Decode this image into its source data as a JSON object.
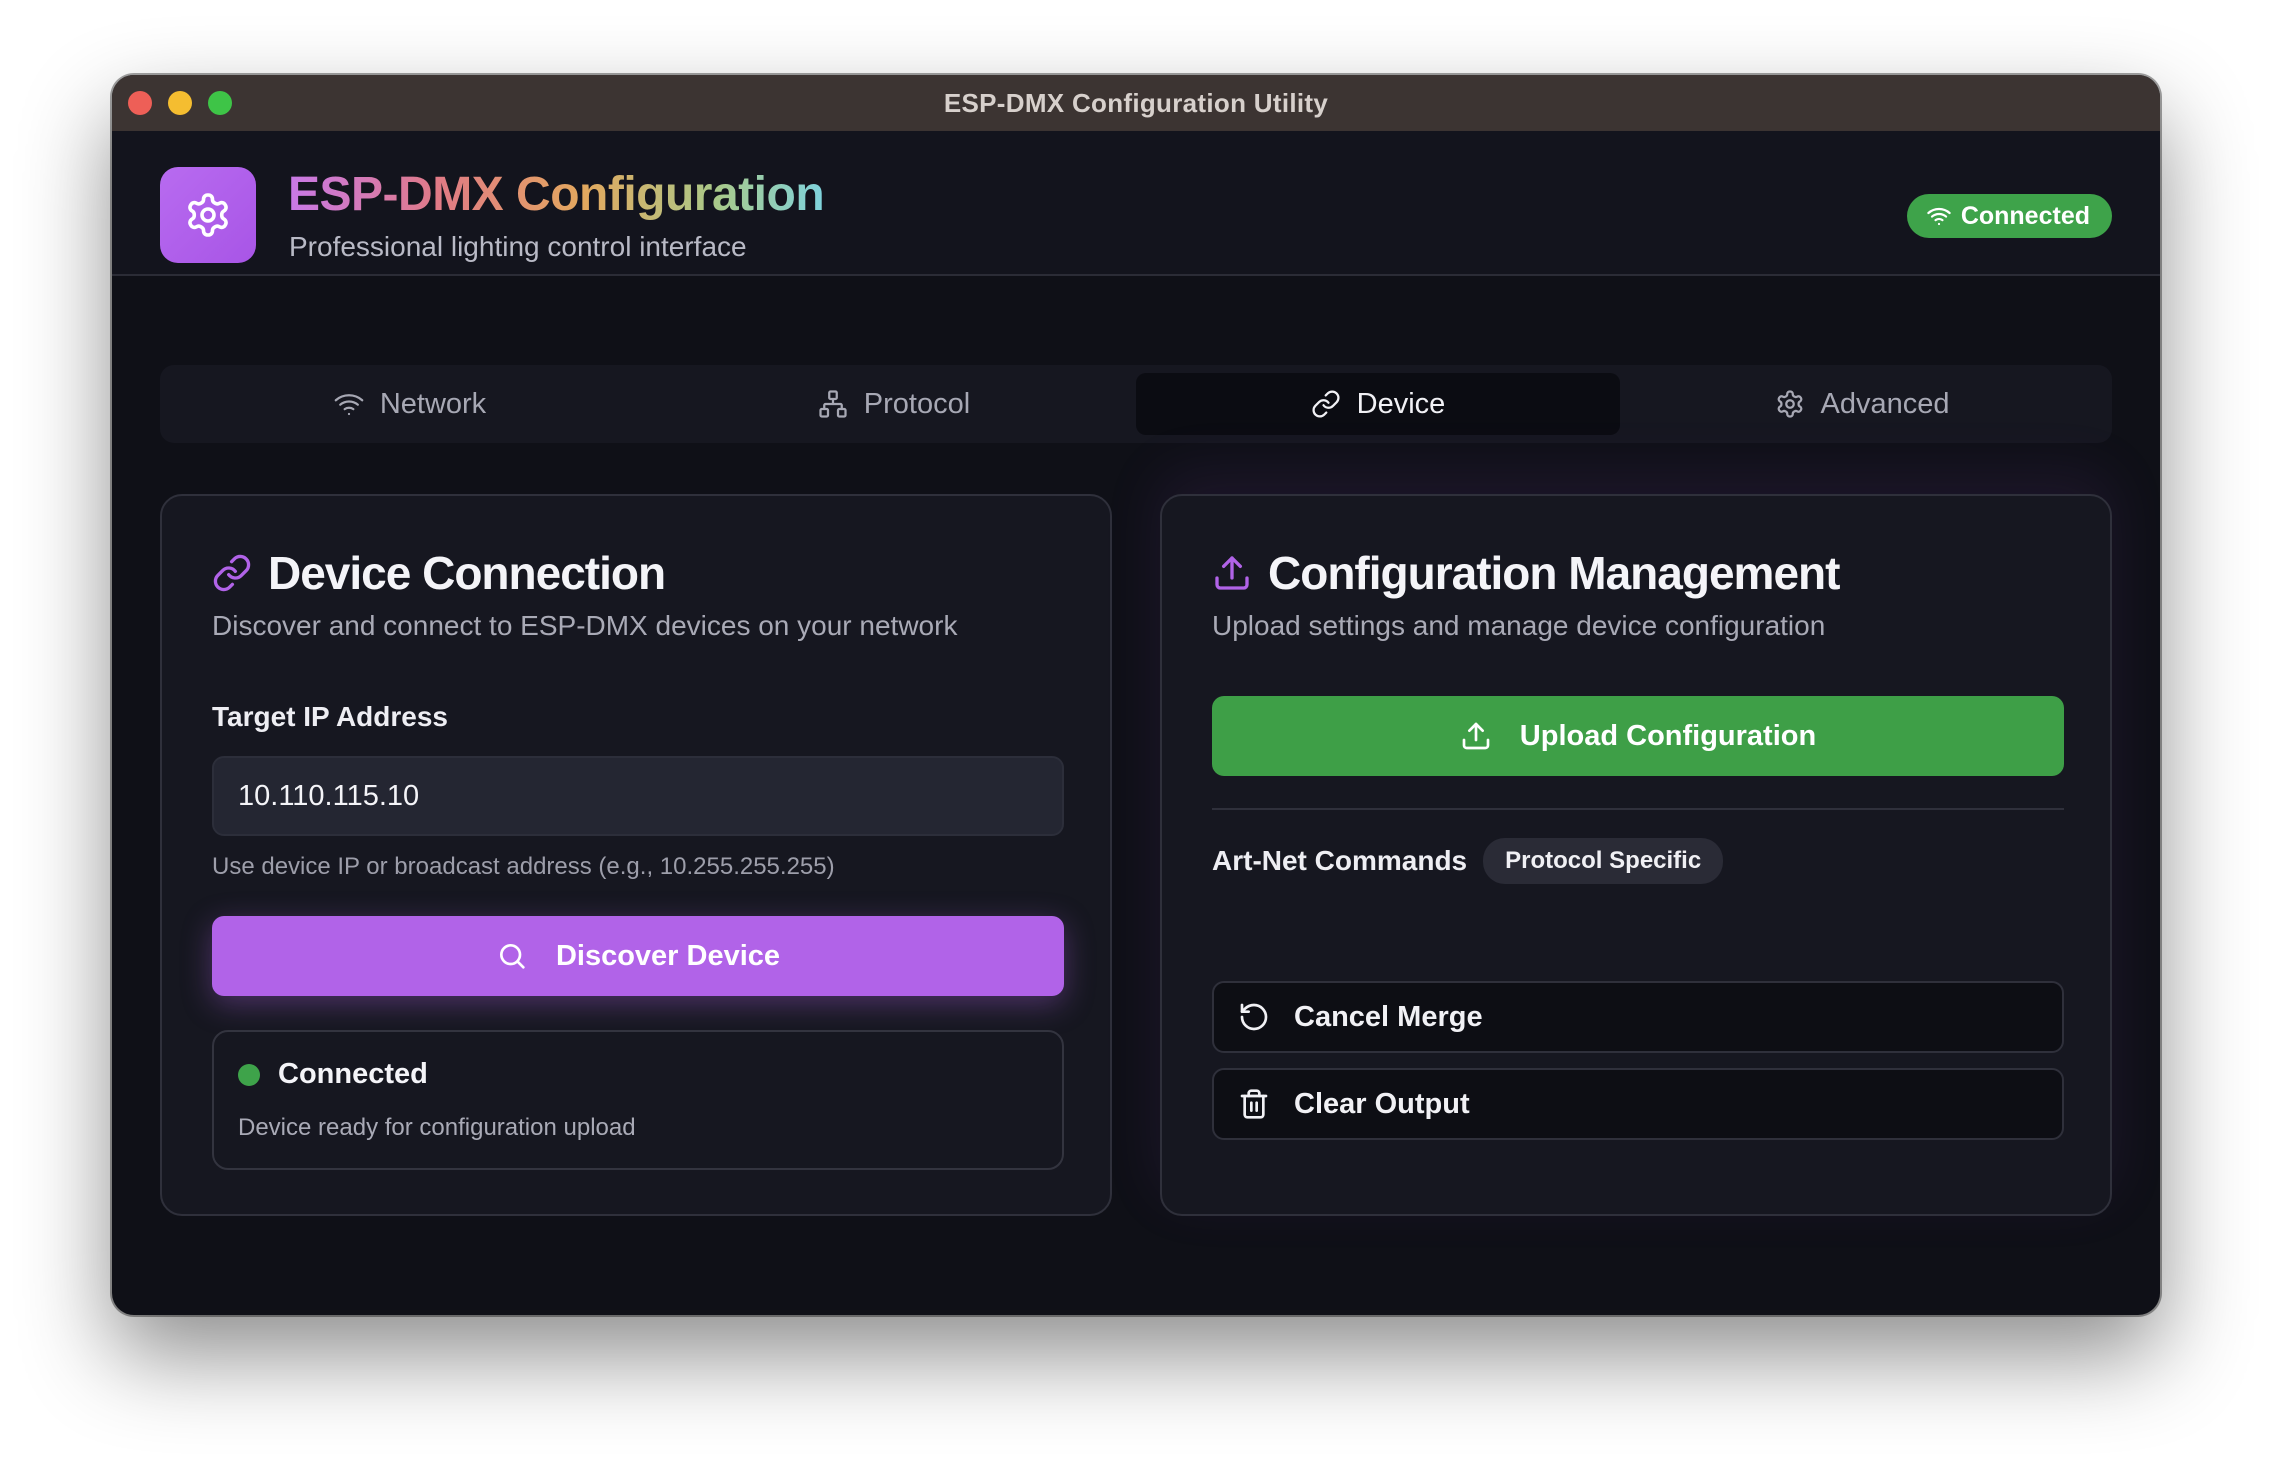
{
  "window": {
    "title": "ESP-DMX Configuration Utility"
  },
  "header": {
    "logo_icon": "gear-icon",
    "title": "ESP-DMX Configuration",
    "subtitle": "Professional lighting control interface",
    "status_badge": {
      "label": "Connected",
      "icon": "wifi-icon",
      "color": "#3ea34a"
    }
  },
  "tabs": [
    {
      "label": "Network",
      "icon": "wifi-icon",
      "active": false
    },
    {
      "label": "Protocol",
      "icon": "network-icon",
      "active": false
    },
    {
      "label": "Device",
      "icon": "link-icon",
      "active": true
    },
    {
      "label": "Advanced",
      "icon": "gear-icon",
      "active": false
    }
  ],
  "device_connection": {
    "title": "Device Connection",
    "title_icon": "link-icon",
    "description": "Discover and connect to ESP-DMX devices on your network",
    "ip_label": "Target IP Address",
    "ip_value": "10.110.115.10",
    "ip_hint": "Use device IP or broadcast address (e.g., 10.255.255.255)",
    "discover_button": "Discover Device",
    "status": {
      "title": "Connected",
      "description": "Device ready for configuration upload",
      "color": "#3ea34a"
    }
  },
  "config_management": {
    "title": "Configuration Management",
    "title_icon": "upload-icon",
    "description": "Upload settings and manage device configuration",
    "upload_button": "Upload Configuration",
    "artnet_label": "Art-Net Commands",
    "artnet_badge": "Protocol Specific",
    "commands": [
      {
        "label": "Cancel Merge",
        "icon": "rotate-ccw-icon"
      },
      {
        "label": "Clear Output",
        "icon": "trash-icon"
      }
    ]
  },
  "colors": {
    "accent_purple": "#b163e8",
    "success_green": "#3e9f47",
    "background": "#0f1017",
    "card": "#161720"
  }
}
